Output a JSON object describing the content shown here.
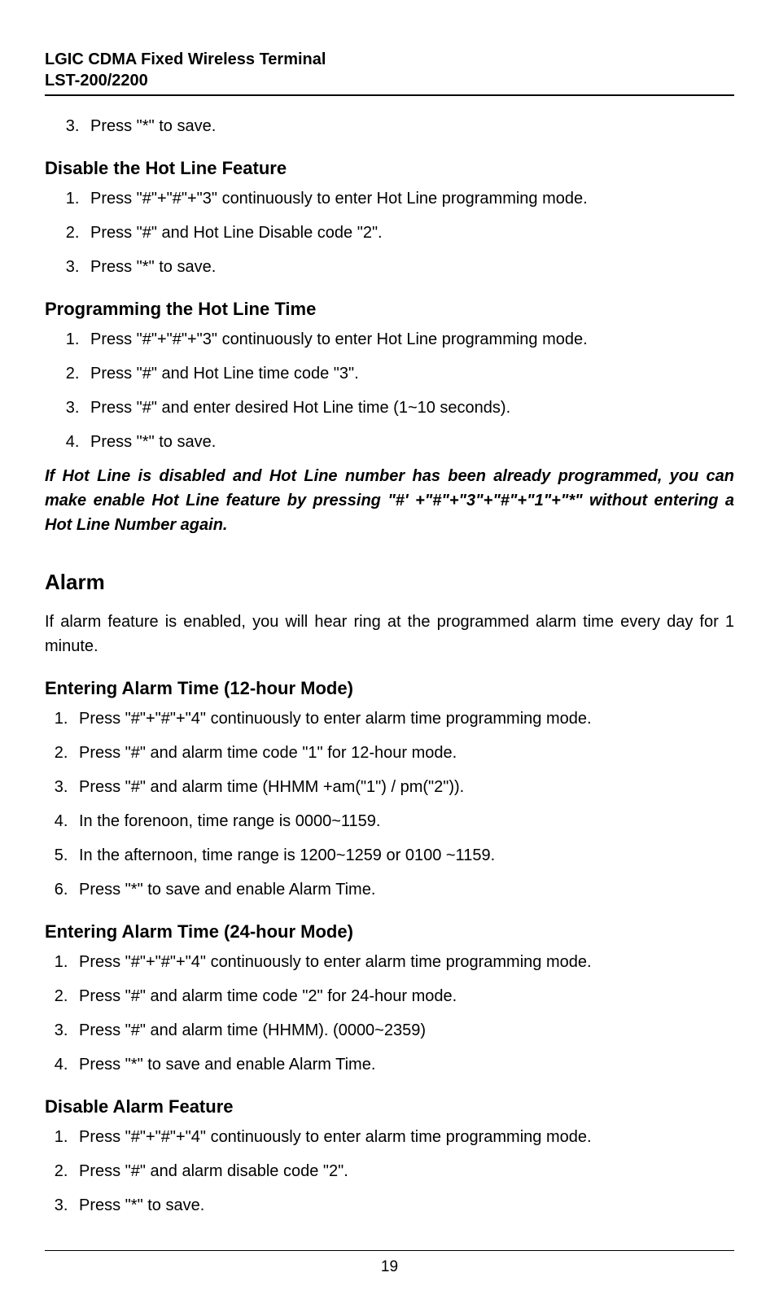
{
  "header": {
    "line1": "LGIC CDMA Fixed Wireless Terminal",
    "line2": "LST-200/2200"
  },
  "sec0": {
    "items": [
      "Press \"*\" to save."
    ],
    "start": 3
  },
  "sec1": {
    "title": "Disable the Hot Line Feature",
    "items": [
      "Press \"#\"+\"#\"+\"3\" continuously to enter Hot Line programming mode.",
      "Press \"#\" and Hot Line Disable code \"2\".",
      "Press \"*\" to save."
    ]
  },
  "sec2": {
    "title": "Programming the Hot Line Time",
    "items": [
      "Press \"#\"+\"#\"+\"3\" continuously to enter Hot Line programming mode.",
      "Press \"#\" and Hot Line time code \"3\".",
      "Press \"#\" and enter desired Hot Line time (1~10 seconds).",
      "Press \"*\" to save."
    ]
  },
  "note1": "If Hot Line is disabled and Hot Line number has been already programmed, you can make enable Hot Line feature by pressing \"#' +\"#\"+\"3\"+\"#\"+\"1\"+\"*\" without entering a Hot Line Number again.",
  "alarm": {
    "title": "Alarm",
    "intro": "If alarm feature is enabled, you will hear ring at the programmed alarm time every day for 1 minute."
  },
  "sec3": {
    "title": "Entering Alarm Time (12-hour Mode)",
    "items": [
      "Press \"#\"+\"#\"+\"4\" continuously to enter alarm time programming mode.",
      "Press \"#\" and alarm time code \"1\" for 12-hour mode.",
      "Press \"#\" and alarm time (HHMM +am(\"1\") / pm(\"2\")).",
      "In the forenoon, time range is 0000~1159.",
      "In the afternoon, time range is 1200~1259 or 0100 ~1159.",
      "Press \"*\" to save and enable Alarm Time."
    ]
  },
  "sec4": {
    "title": "Entering Alarm Time (24-hour Mode)",
    "items": [
      "Press \"#\"+\"#\"+\"4\" continuously to enter alarm time programming mode.",
      "Press \"#\" and alarm time code \"2\" for 24-hour mode.",
      "Press \"#\" and alarm time (HHMM). (0000~2359)",
      "Press \"*\" to save and enable Alarm Time."
    ]
  },
  "sec5": {
    "title": "Disable Alarm Feature",
    "items": [
      "Press \"#\"+\"#\"+\"4\" continuously to enter alarm time programming mode.",
      "Press \"#\" and alarm disable code \"2\".",
      "Press \"*\" to save."
    ]
  },
  "page_number": "19"
}
